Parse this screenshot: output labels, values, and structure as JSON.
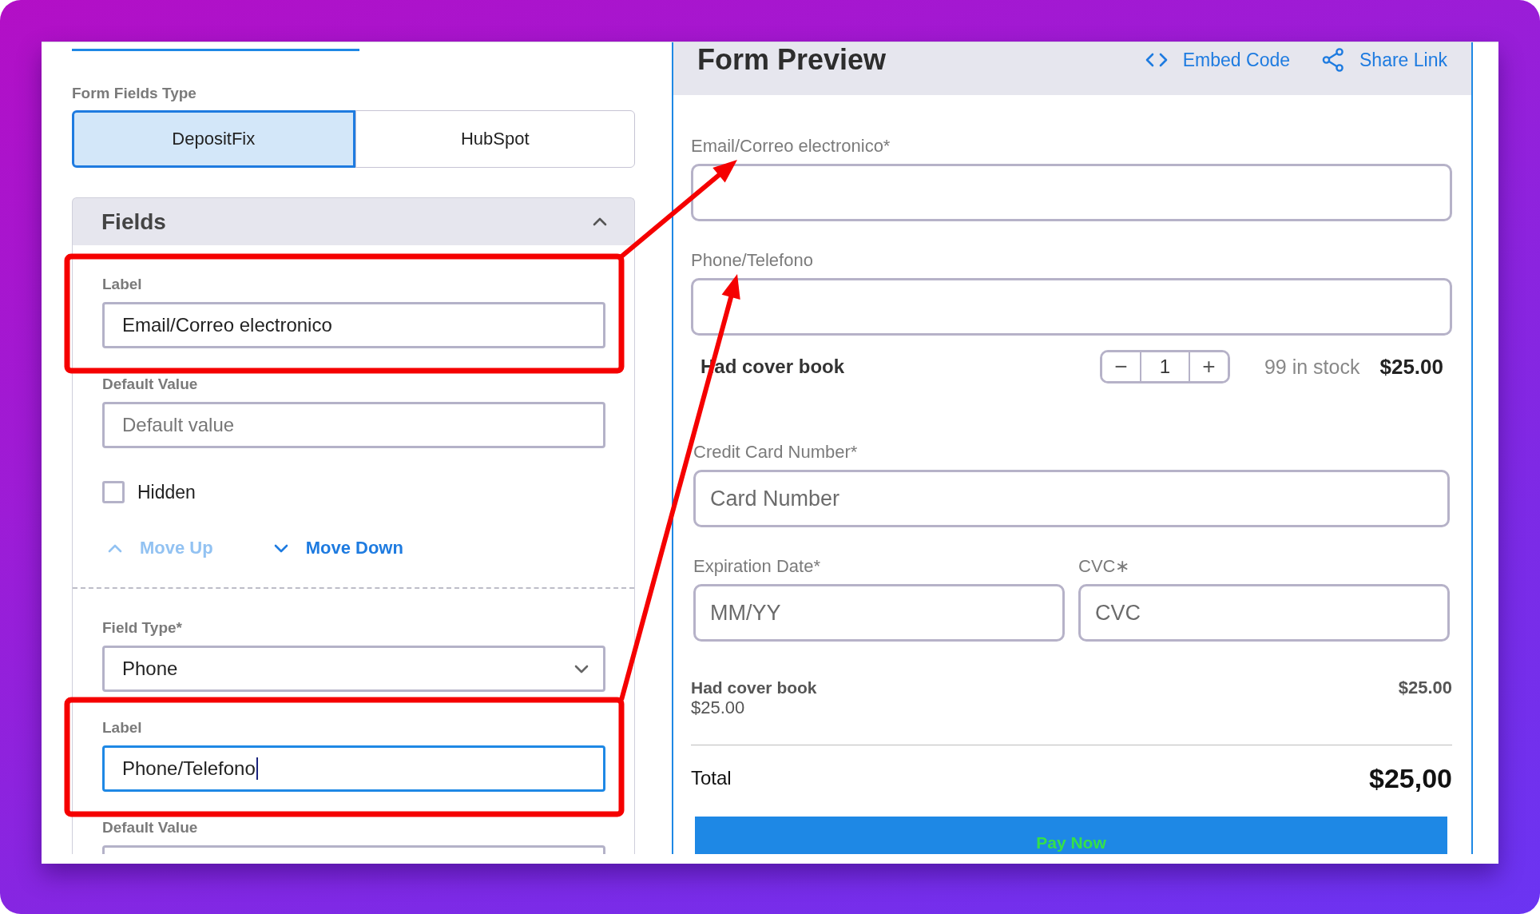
{
  "editor": {
    "field_types": {
      "label": "Form Fields Type",
      "options": [
        {
          "label": "DepositFix",
          "selected": true
        },
        {
          "label": "HubSpot",
          "selected": false
        }
      ]
    },
    "fields_section": {
      "title": "Fields",
      "expanded": true,
      "groups": [
        {
          "items": [
            {
              "kind": "text",
              "label": "Label",
              "value": "Email/Correo electronico",
              "focused": false,
              "highlighted": true
            },
            {
              "kind": "text",
              "label": "Default Value",
              "placeholder": "Default value",
              "focused": false,
              "highlighted": false
            },
            {
              "kind": "checkbox",
              "label": "Hidden",
              "checked": false,
              "highlighted": false
            },
            {
              "kind": "actions",
              "highlighted": false,
              "buttons": [
                {
                  "kind": "up",
                  "label": "Move Up",
                  "disabled": true
                },
                {
                  "kind": "down",
                  "label": "Move Down",
                  "disabled": false
                }
              ]
            }
          ]
        },
        {
          "items": [
            {
              "kind": "select",
              "label": "Field Type*",
              "value": "Phone",
              "focused": false,
              "highlighted": false
            },
            {
              "kind": "text",
              "label": "Label",
              "value": "Phone/Telefono",
              "focused": true,
              "highlighted": true
            },
            {
              "kind": "text",
              "label": "Default Value",
              "focused": false,
              "highlighted": false
            }
          ]
        }
      ]
    }
  },
  "preview": {
    "title": "Form Preview",
    "links": [
      {
        "kind": "embed",
        "label": "Embed Code"
      },
      {
        "kind": "share",
        "label": "Share Link"
      }
    ],
    "fields": [
      {
        "label": "Email/Correo electronico*"
      },
      {
        "label": "Phone/Telefono"
      }
    ],
    "product": {
      "name": "Had cover book",
      "decrement": "−",
      "quantity": "1",
      "increment": "+",
      "stock": "99 in stock",
      "price": "$25.00"
    },
    "card_number": {
      "label": "Credit Card Number*",
      "placeholder": "Card Number"
    },
    "card_details": [
      {
        "label": "Expiration Date*",
        "placeholder": "MM/YY"
      },
      {
        "label": "CVC∗",
        "placeholder": "CVC"
      }
    ],
    "summary": {
      "items": [
        {
          "name": "Had cover book",
          "unit_price": "$25.00",
          "amount": "$25.00"
        }
      ],
      "total_label": "Total",
      "total": "$25,00"
    },
    "pay_button": "Pay Now"
  }
}
